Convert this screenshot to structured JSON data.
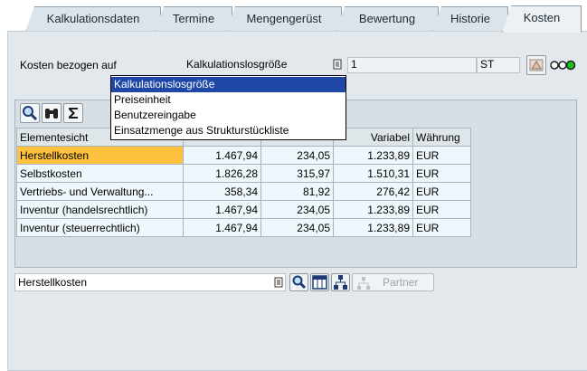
{
  "tabs": [
    {
      "label": "Kalkulationsdaten"
    },
    {
      "label": "Termine"
    },
    {
      "label": "Mengengerüst"
    },
    {
      "label": "Bewertung"
    },
    {
      "label": "Historie"
    },
    {
      "label": "Kosten"
    }
  ],
  "costs_basis": {
    "label": "Kosten bezogen auf",
    "value": "Kalkulationslosgröße",
    "quantity": "1",
    "unit": "ST"
  },
  "dropdown": {
    "options": [
      "Kalkulationslosgröße",
      "Preiseinheit",
      "Benutzereingabe",
      "Einsatzmenge aus Strukturstückliste"
    ]
  },
  "table": {
    "headers": [
      "Elementesicht",
      "",
      "",
      "Variabel",
      "Währung"
    ],
    "rows": [
      {
        "name": "Herstellkosten",
        "c1": "1.467,94",
        "c2": "234,05",
        "c3": "1.233,89",
        "cur": "EUR"
      },
      {
        "name": "Selbstkosten",
        "c1": "1.826,28",
        "c2": "315,97",
        "c3": "1.510,31",
        "cur": "EUR"
      },
      {
        "name": "Vertriebs- und Verwaltung...",
        "c1": "358,34",
        "c2": "81,92",
        "c3": "276,42",
        "cur": "EUR"
      },
      {
        "name": "Inventur (handelsrechtlich)",
        "c1": "1.467,94",
        "c2": "234,05",
        "c3": "1.233,89",
        "cur": "EUR"
      },
      {
        "name": "Inventur (steuerrechtlich)",
        "c1": "1.467,94",
        "c2": "234,05",
        "c3": "1.233,89",
        "cur": "EUR"
      }
    ]
  },
  "bottom": {
    "selection": "Herstellkosten",
    "partner_label": "Partner"
  },
  "colors": {
    "selection_blue": "#1e47a6",
    "highlight_orange": "#fcc23d"
  }
}
